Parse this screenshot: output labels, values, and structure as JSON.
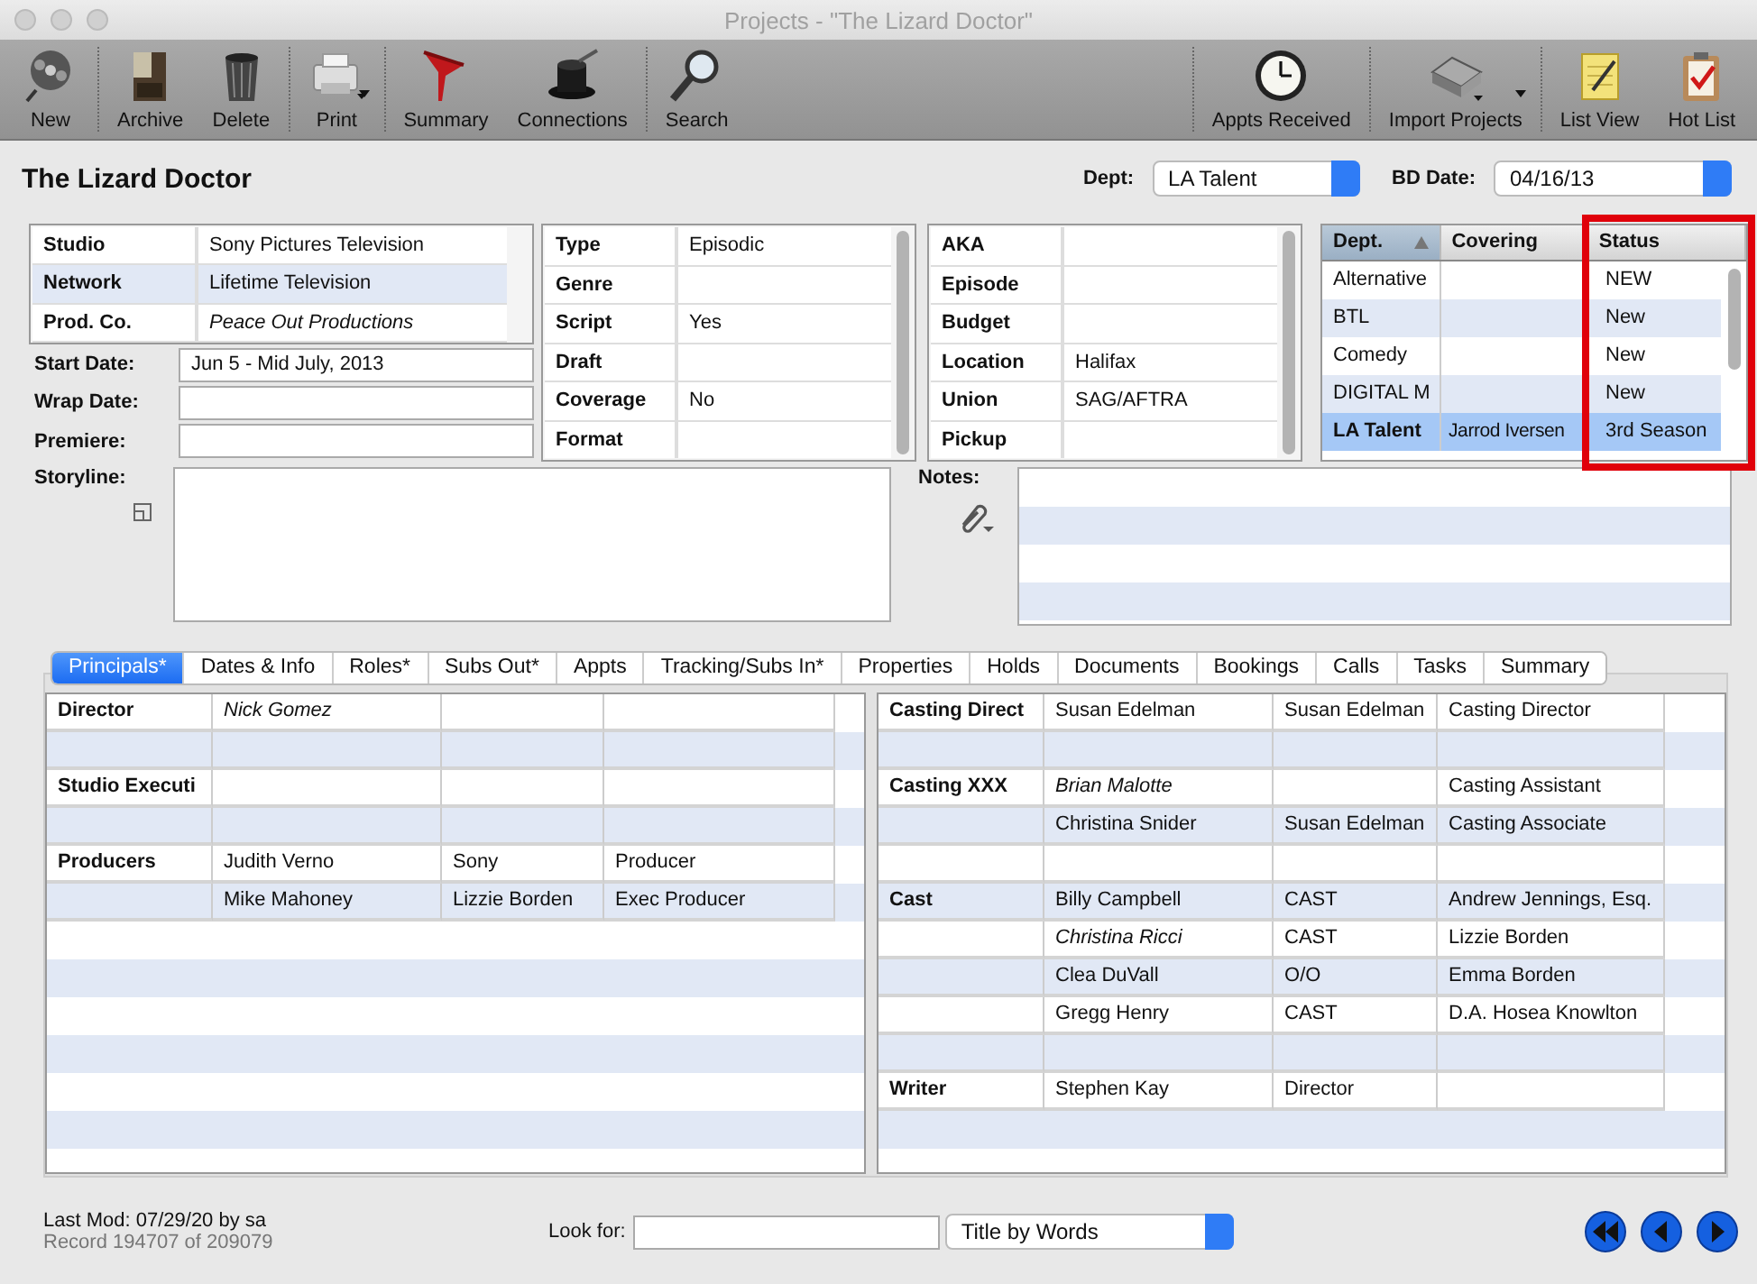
{
  "window": {
    "title": "Projects - \"The Lizard Doctor\""
  },
  "toolbar": {
    "left": [
      [
        {
          "label": "New",
          "kind": "reel",
          "menu": false
        }
      ],
      [
        {
          "label": "Archive",
          "kind": "cabinet",
          "menu": false
        },
        {
          "label": "Delete",
          "kind": "trash",
          "menu": false
        }
      ],
      [
        {
          "label": "Print",
          "kind": "printer",
          "menu": true
        }
      ],
      [
        {
          "label": "Summary",
          "kind": "funnel",
          "menu": false
        },
        {
          "label": "Connections",
          "kind": "hat",
          "menu": false
        }
      ],
      [
        {
          "label": "Search",
          "kind": "magnifier",
          "menu": false
        }
      ]
    ],
    "right": [
      [
        {
          "label": "Appts Received",
          "kind": "clock",
          "menu": false
        }
      ],
      [
        {
          "label": "Import Projects",
          "kind": "machine",
          "menu": true
        }
      ],
      [
        {
          "label": "List View",
          "kind": "notepad",
          "menu": false
        },
        {
          "label": "Hot List",
          "kind": "clipboard",
          "menu": false
        }
      ]
    ]
  },
  "header": {
    "title": "The Lizard Doctor",
    "dept": {
      "label": "Dept:",
      "value": "LA Talent"
    },
    "bd_date": {
      "label": "BD Date:",
      "value": "04/16/13"
    }
  },
  "studio": [
    {
      "label": "Studio",
      "value": "Sony Pictures Television",
      "italic": false
    },
    {
      "label": "Network",
      "value": "Lifetime Television",
      "italic": false
    },
    {
      "label": "Prod. Co.",
      "value": "Peace Out Productions",
      "italic": true
    }
  ],
  "dates": [
    {
      "label": "Start Date:",
      "value": "Jun 5 - Mid July, 2013"
    },
    {
      "label": "Wrap Date:"
    },
    {
      "label": "Premiere:"
    }
  ],
  "details": [
    {
      "label": "Type",
      "value": "Episodic"
    },
    {
      "label": "Genre"
    },
    {
      "label": "Script",
      "value": "Yes"
    },
    {
      "label": "Draft"
    },
    {
      "label": "Coverage",
      "value": "No"
    },
    {
      "label": "Format"
    }
  ],
  "details_2": [
    {
      "label": "AKA"
    },
    {
      "label": "Episode"
    },
    {
      "label": "Budget"
    },
    {
      "label": "Location",
      "value": "Halifax"
    },
    {
      "label": "Union",
      "value": "SAG/AFTRA"
    },
    {
      "label": "Pickup"
    }
  ],
  "departments": {
    "columns": [
      {
        "label": "Dept.",
        "sorted": true,
        "highlighted": false
      },
      {
        "label": "Covering",
        "sorted": false,
        "highlighted": false
      },
      {
        "label": "Status",
        "sorted": false,
        "highlighted": true
      }
    ],
    "rows": [
      {
        "dept": "Alternative",
        "status": "NEW",
        "selected": false
      },
      {
        "dept": "BTL",
        "status": "New",
        "selected": false
      },
      {
        "dept": "Comedy",
        "status": "New",
        "selected": false
      },
      {
        "dept": "DIGITAL M",
        "status": "New",
        "selected": false
      },
      {
        "dept": "LA Talent",
        "covering": "Jarrod Iversen",
        "status": "3rd Season",
        "selected": true
      }
    ]
  },
  "storyline": {
    "label": "Storyline:"
  },
  "notes": {
    "label": "Notes:"
  },
  "tabs": [
    {
      "label": "Principals*",
      "selected": true
    },
    {
      "label": "Dates & Info",
      "selected": false
    },
    {
      "label": "Roles*",
      "selected": false
    },
    {
      "label": "Subs Out*",
      "selected": false
    },
    {
      "label": "Appts",
      "selected": false
    },
    {
      "label": "Tracking/Subs In*",
      "selected": false
    },
    {
      "label": "Properties",
      "selected": false
    },
    {
      "label": "Holds",
      "selected": false
    },
    {
      "label": "Documents",
      "selected": false
    },
    {
      "label": "Bookings",
      "selected": false
    },
    {
      "label": "Calls",
      "selected": false
    },
    {
      "label": "Tasks",
      "selected": false
    },
    {
      "label": "Summary",
      "selected": false
    }
  ],
  "principals_left": [
    {
      "kind": "entry",
      "role": "Director",
      "name": "Nick  Gomez",
      "italic": true
    },
    {
      "kind": "blank"
    },
    {
      "kind": "entry",
      "role": "Studio Executi"
    },
    {
      "kind": "blank"
    },
    {
      "kind": "entry",
      "role": "Producers",
      "name": "Judith Verno",
      "company": "Sony",
      "title": "Producer",
      "italic": false
    },
    {
      "kind": "entry",
      "name": "Mike Mahoney",
      "company": "Lizzie Borden",
      "title": "Exec Producer",
      "italic": false
    }
  ],
  "principals_right": [
    {
      "kind": "entry",
      "role": "Casting Direct",
      "name": "Susan Edelman",
      "company": "Susan Edelman",
      "title": "Casting Director",
      "italic": false
    },
    {
      "kind": "blank"
    },
    {
      "kind": "entry",
      "role": "Casting XXX",
      "name": "Brian Malotte",
      "title": "Casting Assistant",
      "italic": true
    },
    {
      "kind": "entry",
      "name": "Christina Snider",
      "company": "Susan Edelman",
      "title": "Casting Associate",
      "italic": false
    },
    {
      "kind": "blank"
    },
    {
      "kind": "entry",
      "role": "Cast",
      "name": "Billy Campbell",
      "company": "CAST",
      "title": "Andrew Jennings, Esq.",
      "italic": false
    },
    {
      "kind": "entry",
      "name": "Christina Ricci",
      "company": "CAST",
      "title": "Lizzie Borden",
      "italic": true
    },
    {
      "kind": "entry",
      "name": "Clea DuVall",
      "company": "O/O",
      "title": "Emma Borden",
      "italic": false
    },
    {
      "kind": "entry",
      "name": "Gregg Henry",
      "company": "CAST",
      "title": "D.A. Hosea Knowlton",
      "italic": false
    },
    {
      "kind": "blank"
    },
    {
      "kind": "entry",
      "role": "Writer",
      "name": "Stephen Kay",
      "company": "Director",
      "italic": false
    }
  ],
  "footer": {
    "last_mod": "Last Mod: 07/29/20 by sa",
    "record": "Record 194707 of 209079",
    "look_for": "Look for:",
    "search_mode": "Title by Words"
  }
}
